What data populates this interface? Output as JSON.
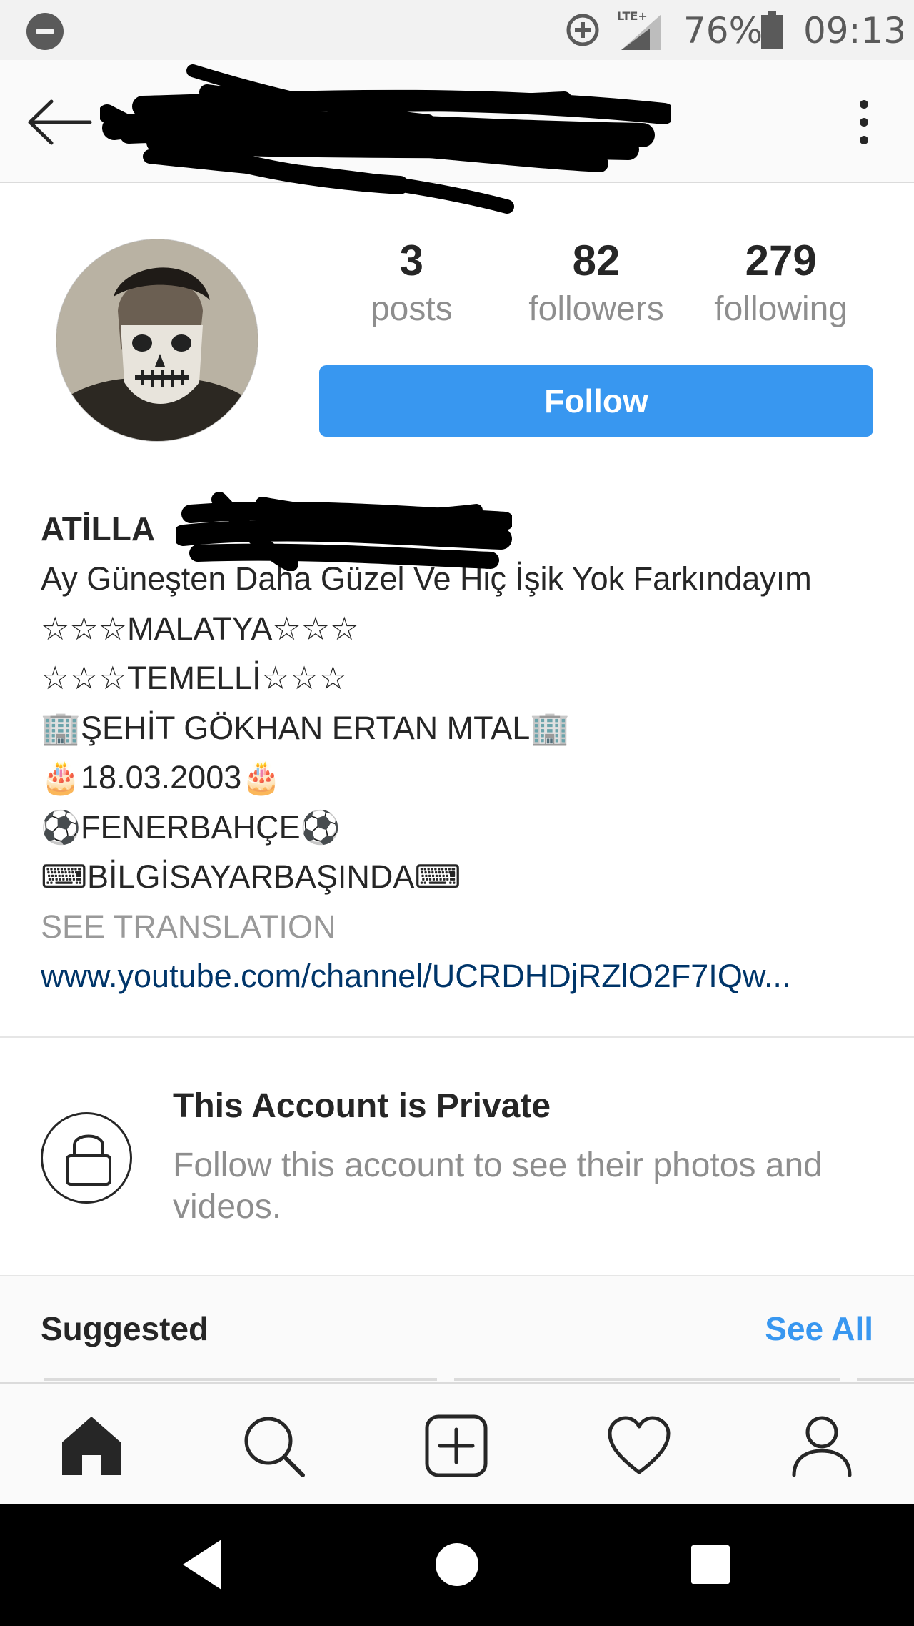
{
  "status_bar": {
    "battery_percent": "76%",
    "time": "09:13",
    "network": "LTE+",
    "icons": [
      "do-not-disturb-icon",
      "data-saver-icon",
      "signal-icon",
      "battery-icon"
    ]
  },
  "top_bar": {
    "back_icon": "arrow-left-icon",
    "more_icon": "more-vertical-icon"
  },
  "profile": {
    "stats": [
      {
        "value": "3",
        "label": "posts"
      },
      {
        "value": "82",
        "label": "followers"
      },
      {
        "value": "279",
        "label": "following"
      }
    ],
    "follow_button": "Follow"
  },
  "bio": {
    "name": "ATİLLA",
    "lines": [
      "Ay Güneşten Daha Güzel Ve Hiç İşik Yok Farkındayım",
      "☆☆☆MALATYA☆☆☆",
      "☆☆☆TEMELLİ☆☆☆",
      "🏢ŞEHİT GÖKHAN ERTAN MTAL🏢",
      "🎂18.03.2003🎂",
      "⚽FENERBAHÇE⚽",
      "⌨BİLGİSAYARBAŞINDA⌨"
    ],
    "see_translation": "SEE TRANSLATION",
    "link": "www.youtube.com/channel/UCRDHDjRZlO2F7IQw..."
  },
  "private_notice": {
    "title": "This Account is Private",
    "description": "Follow this account to see their photos and videos."
  },
  "suggested": {
    "title": "Suggested",
    "see_all": "See All"
  },
  "bottom_nav": [
    "home-icon",
    "search-icon",
    "add-post-icon",
    "activity-heart-icon",
    "profile-icon"
  ],
  "colors": {
    "accent": "#3897f0",
    "link": "#003569",
    "secondary_text": "#8e8e8e"
  }
}
